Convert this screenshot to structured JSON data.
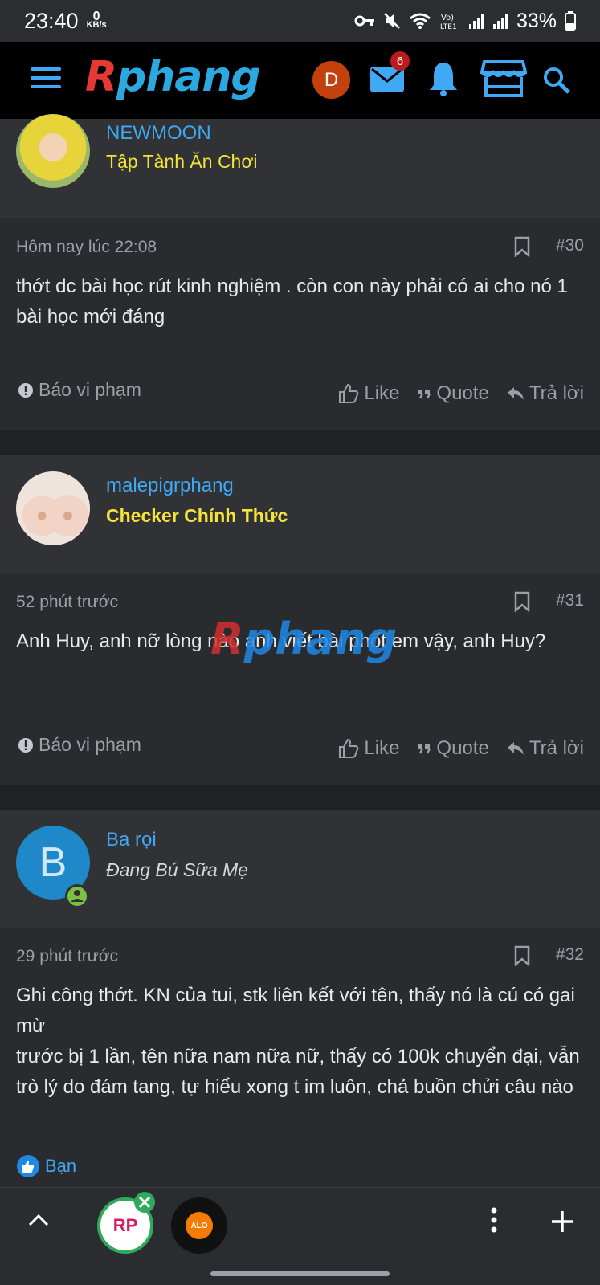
{
  "status_bar": {
    "time": "23:40",
    "speed_value": "0",
    "speed_unit": "KB/s",
    "battery": "33%"
  },
  "header": {
    "logo": "Rphang",
    "logo_first": "R",
    "logo_rest": "phang",
    "avatar_letter": "D",
    "messages_badge": "6"
  },
  "posts": [
    {
      "author": "NEWMOON",
      "author_title": "Tập Tành Ăn Chơi",
      "time": "Hôm nay lúc 22:08",
      "number": "#30",
      "message": "thớt dc bài học rút kinh nghiệm . còn con này phải có ai cho nó 1 bài học mới đáng",
      "report": "Báo vi phạm",
      "like": "Like",
      "quote": "Quote",
      "reply": "Trả lời"
    },
    {
      "author": "malepigrphang",
      "author_title": "Checker Chính Thức",
      "time": "52 phút trước",
      "number": "#31",
      "message": "Anh Huy, anh nỡ lòng nào anh viết bài phốt em vậy, anh Huy?",
      "report": "Báo vi phạm",
      "like": "Like",
      "quote": "Quote",
      "reply": "Trả lời"
    },
    {
      "author": "Ba rọi",
      "author_title": "Đang Bú Sữa Mẹ",
      "avatar_letter": "B",
      "time": "29 phút trước",
      "number": "#32",
      "message_line1": "Ghi công thớt. KN của tui, stk liên kết với tên, thấy nó là cú có gai mừ",
      "message_line2": "trước bị 1 lần, tên nữa nam nữa nữ, thấy có 100k chuyển đại, vẫn trò lý do đám tang, tự hiểu xong t im luôn, chả buồn chửi câu nào",
      "reaction_label": "Bạn"
    }
  ],
  "watermark": {
    "first": "R",
    "rest": "phang"
  },
  "bottom_bar": {
    "app1_label": "RP",
    "app2_label": "ALO"
  },
  "colors": {
    "accent": "#3fa9f5",
    "title_yellow": "#f5e33a",
    "background": "#1f2124"
  }
}
